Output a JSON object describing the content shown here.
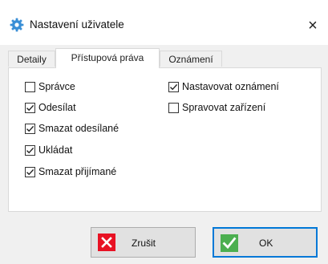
{
  "window": {
    "title": "Nastavení uživatele",
    "close_icon": "×"
  },
  "tabs": [
    {
      "label": "Detaily",
      "active": false
    },
    {
      "label": "Přístupová práva",
      "active": true
    },
    {
      "label": "Oznámení",
      "active": false
    }
  ],
  "permissions": {
    "left": [
      {
        "label": "Správce",
        "checked": false
      },
      {
        "label": "Odesílat",
        "checked": true
      },
      {
        "label": "Smazat odesílané",
        "checked": true
      },
      {
        "label": "Ukládat",
        "checked": true
      },
      {
        "label": "Smazat přijímané",
        "checked": true
      }
    ],
    "right": [
      {
        "label": "Nastavovat oznámení",
        "checked": true
      },
      {
        "label": "Spravovat zařízení",
        "checked": false
      }
    ]
  },
  "buttons": {
    "cancel_label": "Zrušit",
    "ok_label": "OK"
  },
  "colors": {
    "accent": "#0078d7",
    "cancel_icon_bg": "#e81123",
    "ok_icon_bg": "#4caf50"
  }
}
